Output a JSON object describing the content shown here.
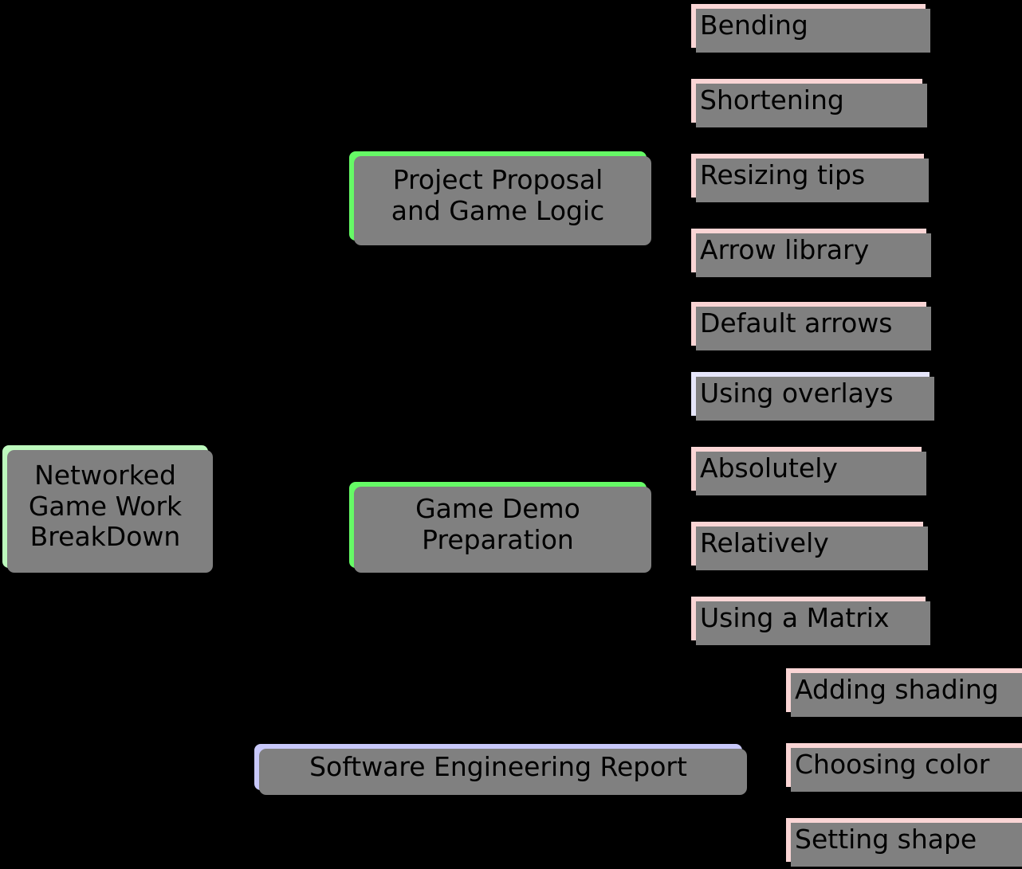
{
  "diagram": {
    "type": "mind-map",
    "title": "Networked Game Work BreakDown",
    "background_color": "#000000",
    "colors": {
      "root_fill": "#bdf9bd",
      "branch_fill": "#66f966",
      "report_fill": "#c8c8fa",
      "leaf_fill": "#fad5d5",
      "leaf_alt_fill": "#e6e6fa",
      "shadow": "#808080",
      "border": "#000000",
      "text": "#000000"
    }
  },
  "root": {
    "label": "Networked\nGame Work\nBreakDown"
  },
  "branches": [
    {
      "id": "project-proposal",
      "label": "Project Proposal\nand Game Logic"
    },
    {
      "id": "game-demo",
      "label": "Game Demo\nPreparation"
    },
    {
      "id": "se-report",
      "label": "Software Engineering Report"
    }
  ],
  "leaves": [
    {
      "id": "bending",
      "label": "Bending",
      "style": "pink"
    },
    {
      "id": "shortening",
      "label": "Shortening",
      "style": "pink"
    },
    {
      "id": "resizing-tips",
      "label": "Resizing tips",
      "style": "pink"
    },
    {
      "id": "arrow-library",
      "label": "Arrow library",
      "style": "pink"
    },
    {
      "id": "default-arrows",
      "label": "Default arrows",
      "style": "pink"
    },
    {
      "id": "using-overlays",
      "label": "Using overlays",
      "style": "lavender"
    },
    {
      "id": "absolutely",
      "label": "Absolutely",
      "style": "pink"
    },
    {
      "id": "relatively",
      "label": "Relatively",
      "style": "pink"
    },
    {
      "id": "using-a-matrix",
      "label": "Using a Matrix",
      "style": "pink"
    },
    {
      "id": "adding-shading",
      "label": "Adding shading",
      "style": "pink"
    },
    {
      "id": "choosing-color",
      "label": "Choosing color",
      "style": "pink"
    },
    {
      "id": "setting-shape",
      "label": "Setting shape",
      "style": "pink"
    }
  ]
}
